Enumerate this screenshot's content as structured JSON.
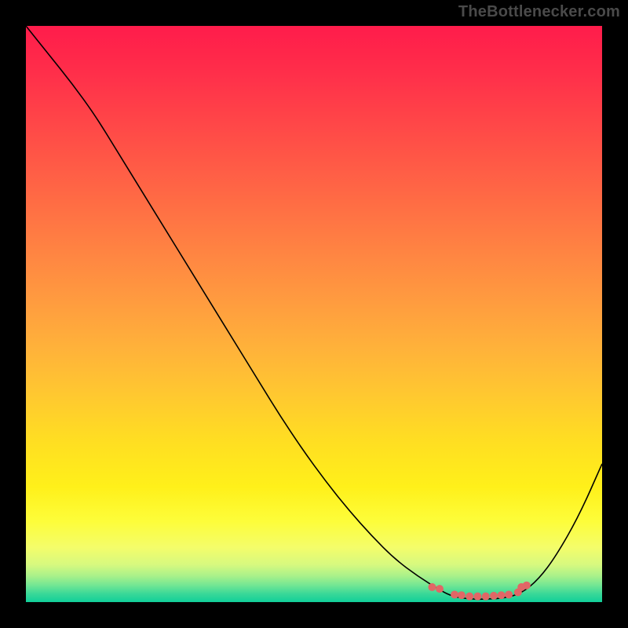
{
  "attribution": "TheBottlenecker.com",
  "chart_data": {
    "type": "line",
    "title": "",
    "xlabel": "",
    "ylabel": "",
    "xlim": [
      0,
      100
    ],
    "ylim": [
      0,
      100
    ],
    "series": [
      {
        "name": "curve",
        "x": [
          0,
          4,
          8,
          12,
          16,
          20,
          24,
          28,
          32,
          36,
          40,
          44,
          48,
          52,
          56,
          60,
          64,
          68,
          72,
          74,
          77,
          80,
          83,
          86,
          89,
          92,
          96,
          100
        ],
        "y": [
          100,
          95,
          90,
          84.5,
          78,
          71.5,
          65,
          58.5,
          52,
          45.5,
          39,
          32.5,
          26.5,
          21,
          16,
          11.5,
          7.5,
          4.5,
          2,
          1,
          0.5,
          0.5,
          0.7,
          1.5,
          4,
          8,
          15,
          24
        ],
        "stroke": "#000000",
        "stroke_width": 1.6
      },
      {
        "name": "dots",
        "type": "scatter",
        "x": [
          70.5,
          71.8,
          74.4,
          75.6,
          77,
          78.4,
          79.8,
          81.2,
          82.5,
          83.8,
          85.4,
          86,
          86.9
        ],
        "y": [
          2.6,
          2.3,
          1.3,
          1.2,
          1.0,
          1.0,
          1.0,
          1.1,
          1.2,
          1.3,
          1.7,
          2.6,
          2.9
        ],
        "color": "#e16666",
        "radius": 5
      }
    ],
    "background_gradient": {
      "stops": [
        {
          "offset": 0.0,
          "color": "#ff1c4b"
        },
        {
          "offset": 0.08,
          "color": "#ff2e4a"
        },
        {
          "offset": 0.16,
          "color": "#ff4448"
        },
        {
          "offset": 0.24,
          "color": "#ff5a46"
        },
        {
          "offset": 0.32,
          "color": "#ff7044"
        },
        {
          "offset": 0.4,
          "color": "#ff8642"
        },
        {
          "offset": 0.48,
          "color": "#ff9c3f"
        },
        {
          "offset": 0.56,
          "color": "#ffb23a"
        },
        {
          "offset": 0.64,
          "color": "#ffc830"
        },
        {
          "offset": 0.72,
          "color": "#ffde22"
        },
        {
          "offset": 0.8,
          "color": "#fff01a"
        },
        {
          "offset": 0.86,
          "color": "#fdfd3a"
        },
        {
          "offset": 0.905,
          "color": "#f4fd6a"
        },
        {
          "offset": 0.935,
          "color": "#d7f97f"
        },
        {
          "offset": 0.955,
          "color": "#a8f18a"
        },
        {
          "offset": 0.972,
          "color": "#6ee594"
        },
        {
          "offset": 0.986,
          "color": "#38d898"
        },
        {
          "offset": 1.0,
          "color": "#11cf99"
        }
      ]
    }
  }
}
